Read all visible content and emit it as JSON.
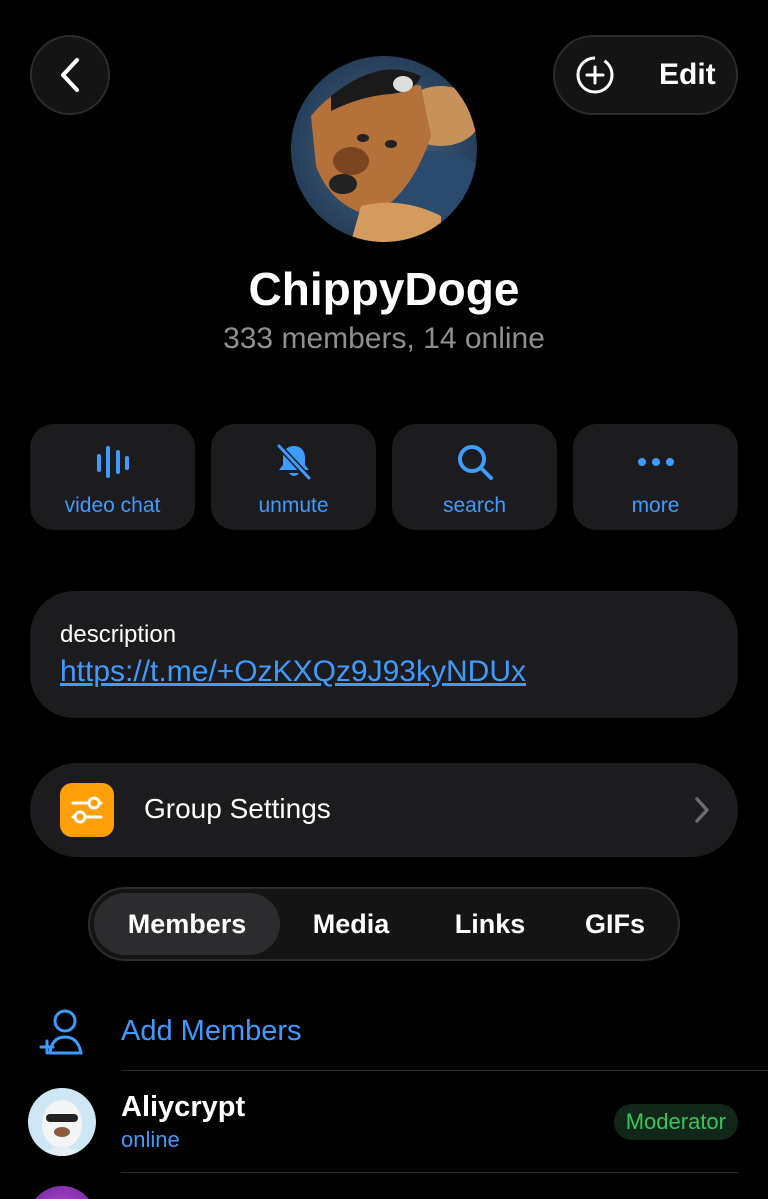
{
  "header": {
    "edit_label": "Edit",
    "back_icon": "chevron-left-icon",
    "add_story_icon": "circle-plus-icon"
  },
  "group": {
    "name": "ChippyDoge",
    "subtitle": "333 members, 14 online"
  },
  "actions": [
    {
      "label": "video chat",
      "icon": "waveform-icon"
    },
    {
      "label": "unmute",
      "icon": "bell-slash-icon"
    },
    {
      "label": "search",
      "icon": "search-icon"
    },
    {
      "label": "more",
      "icon": "ellipsis-icon"
    }
  ],
  "description": {
    "label": "description",
    "link": "https://t.me/+OzKXQz9J93kyNDUx"
  },
  "settings": {
    "label": "Group Settings",
    "icon": "sliders-icon",
    "icon_color": "#ff9f0a"
  },
  "tabs": [
    {
      "label": "Members",
      "active": true
    },
    {
      "label": "Media",
      "active": false
    },
    {
      "label": "Links",
      "active": false
    },
    {
      "label": "GIFs",
      "active": false
    }
  ],
  "add_members": {
    "label": "Add Members",
    "icon": "add-person-icon"
  },
  "members": [
    {
      "name": "Aliycrypt",
      "status": "online",
      "badge": "Moderator"
    }
  ],
  "colors": {
    "accent": "#3e9bff",
    "background": "#000000",
    "card": "#1c1c1e",
    "moderator": "#34c759"
  }
}
